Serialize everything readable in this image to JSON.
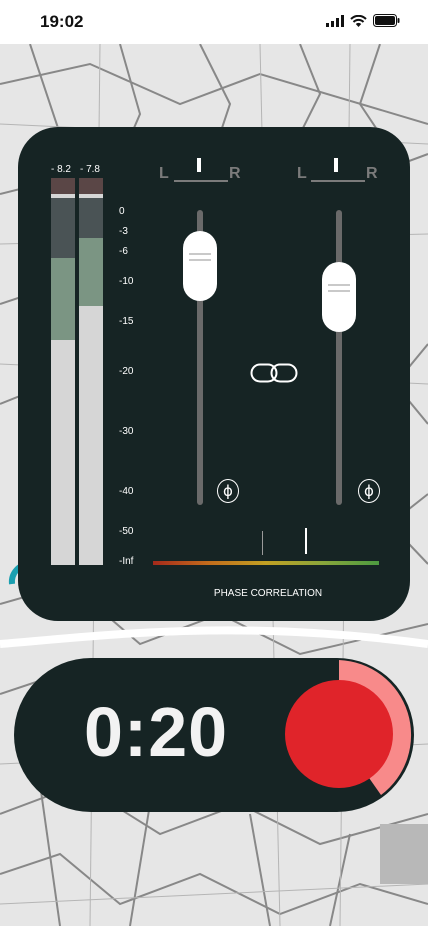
{
  "status": {
    "time": "19:02"
  },
  "meters": {
    "left": {
      "readout": "- 8.2"
    },
    "right": {
      "readout": "- 7.8"
    }
  },
  "scale": [
    "0",
    "-3",
    "-6",
    "-10",
    "-15",
    "-20",
    "-30",
    "-40",
    "-50",
    "-Inf"
  ],
  "channels": [
    {
      "left_label": "L",
      "right_label": "R"
    },
    {
      "left_label": "L",
      "right_label": "R"
    }
  ],
  "phase": {
    "symbol": "ɸ",
    "label": "PHASE CORRELATION"
  },
  "timer": {
    "display": "0:20"
  },
  "colors": {
    "panel": "#162424",
    "record": "#e0242a",
    "record_ring": "#f88a8a"
  }
}
